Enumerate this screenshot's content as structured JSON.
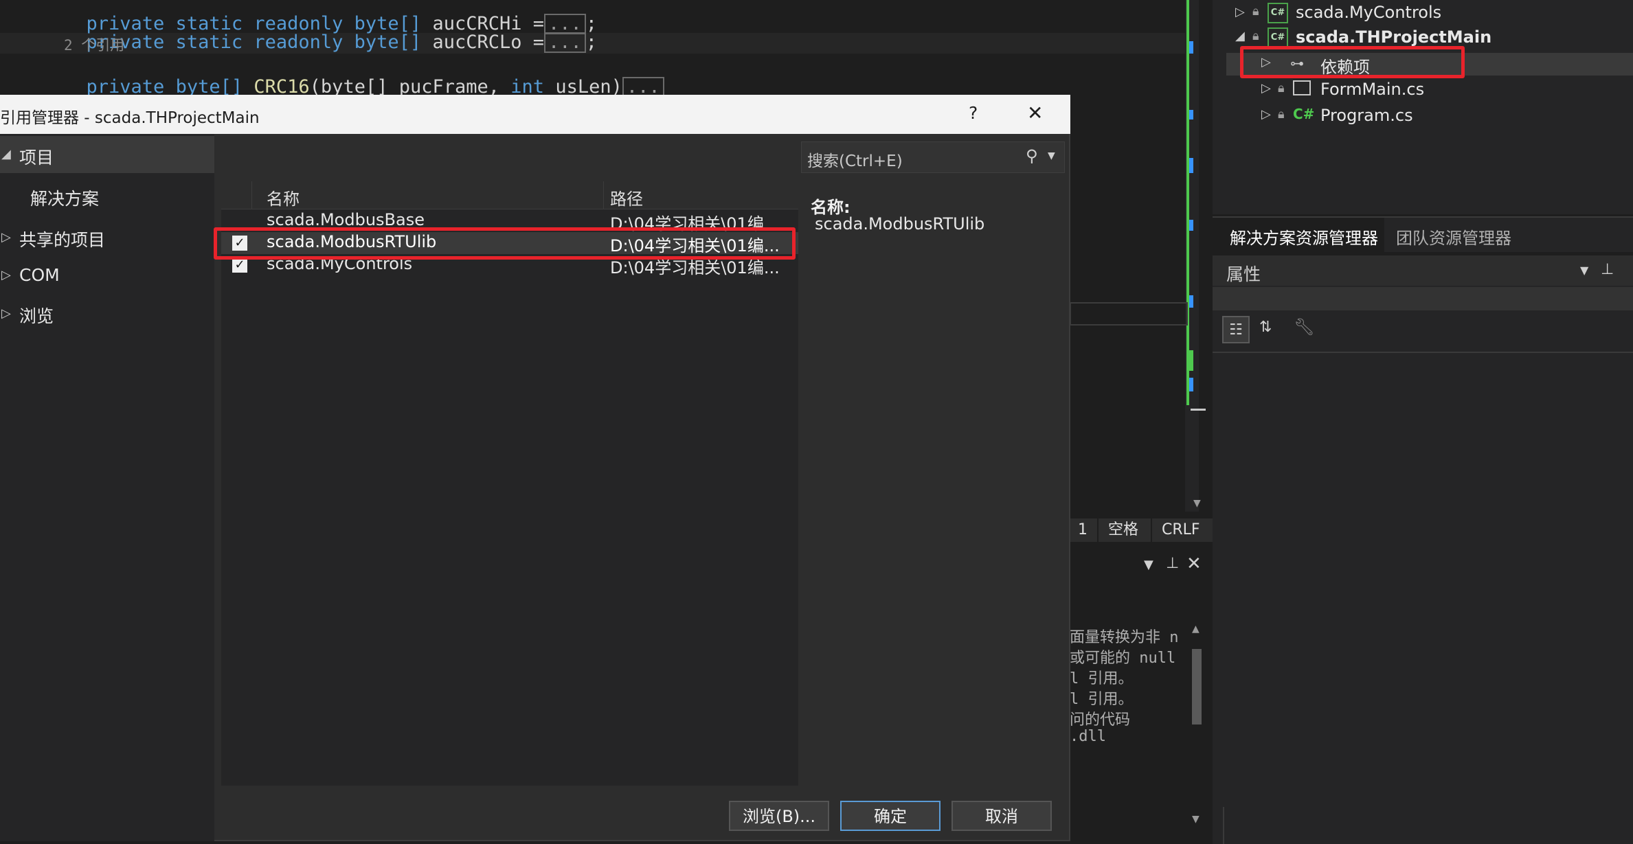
{
  "editor": {
    "line1_kw": "private static readonly byte[]",
    "line1_id": " aucCRCHi =",
    "line2_kw": "private static readonly byte[]",
    "line2_id": " aucCRCLo =",
    "ref_count": "2 个引用",
    "line3_kw1": "private",
    "line3_kw2": "byte[]",
    "line3_fn": "CRC16",
    "line3_p1": "(byte[] pucFrame, ",
    "line3_kw3": "int",
    "line3_p2": " usLen)",
    "collapsed": "...",
    "semicolon": ";"
  },
  "status": {
    "line_end": "1",
    "space": "空格",
    "eol": "CRLF"
  },
  "output": {
    "lines": [
      "面量转换为非 n",
      "或可能的 null",
      "l 引用。",
      "l 引用。",
      "问的代码",
      ".dll"
    ]
  },
  "solution_explorer": {
    "items": [
      {
        "label": "scada.MyControls",
        "icon": "C#"
      },
      {
        "label": "scada.THProjectMain",
        "icon": "C#"
      },
      {
        "label": "依赖项"
      },
      {
        "label": "FormMain.cs"
      },
      {
        "label": "Program.cs",
        "icon": "C#"
      }
    ],
    "tabs": [
      "解决方案资源管理器",
      "团队资源管理器"
    ]
  },
  "properties": {
    "title": "属性"
  },
  "dialog": {
    "title": "引用管理器 - scada.THProjectMain",
    "help": "?",
    "close": "✕",
    "nav": {
      "project": "项目",
      "solution": "解决方案",
      "shared": "共享的项目",
      "com": "COM",
      "browse": "浏览"
    },
    "search_placeholder": "搜索(Ctrl+E)",
    "columns": {
      "name": "名称",
      "path": "路径"
    },
    "rows": [
      {
        "name": "scada.ModbusBase",
        "path": "D:\\04学习相关\\01编...",
        "checked": false
      },
      {
        "name": "scada.ModbusRTUlib",
        "path": "D:\\04学习相关\\01编...",
        "checked": true
      },
      {
        "name": "scada.MyControls",
        "path": "D:\\04学习相关\\01编...",
        "checked": true
      }
    ],
    "detail_label": "名称:",
    "detail_value": "scada.ModbusRTUlib",
    "buttons": {
      "browse": "浏览(B)...",
      "ok": "确定",
      "cancel": "取消"
    }
  },
  "colors": {
    "accent": "#569cd6",
    "highlight_red": "#e8232b",
    "change_green": "#4ec94e",
    "change_blue": "#3794ff"
  }
}
